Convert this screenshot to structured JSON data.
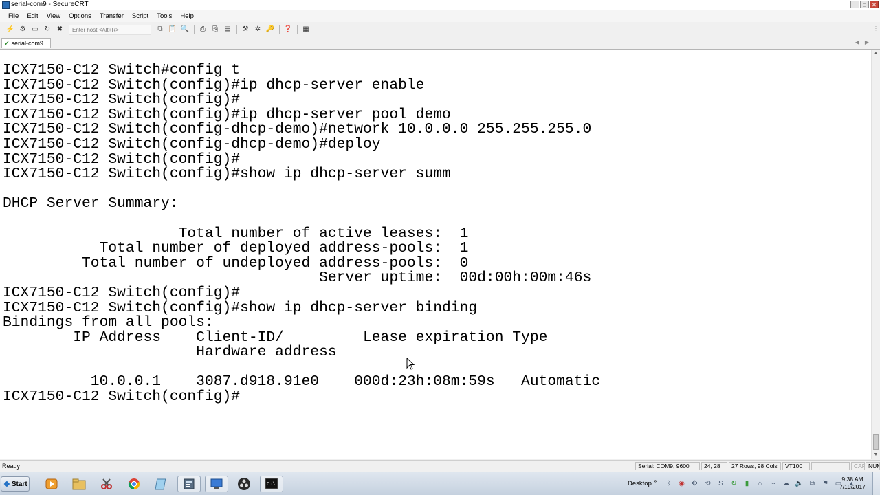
{
  "window": {
    "title": "serial-com9 - SecureCRT",
    "buttons": {
      "minimize": "_",
      "maximize": "□",
      "close": "✕"
    }
  },
  "menu": [
    "File",
    "Edit",
    "View",
    "Options",
    "Transfer",
    "Script",
    "Tools",
    "Help"
  ],
  "toolbar": {
    "quick_connect_placeholder": "Enter host <Alt+R>"
  },
  "tabs": [
    {
      "label": "serial-com9",
      "icon": "check-icon"
    }
  ],
  "terminal": {
    "lines": [
      "ICX7150-C12 Switch#config t",
      "ICX7150-C12 Switch(config)#ip dhcp-server enable",
      "ICX7150-C12 Switch(config)#",
      "ICX7150-C12 Switch(config)#ip dhcp-server pool demo",
      "ICX7150-C12 Switch(config-dhcp-demo)#network 10.0.0.0 255.255.255.0",
      "ICX7150-C12 Switch(config-dhcp-demo)#deploy",
      "ICX7150-C12 Switch(config)#",
      "ICX7150-C12 Switch(config)#show ip dhcp-server summ",
      "",
      "DHCP Server Summary:",
      "",
      "                    Total number of active leases:  1",
      "           Total number of deployed address-pools:  1",
      "         Total number of undeployed address-pools:  0",
      "                                    Server uptime:  00d:00h:00m:46s",
      "ICX7150-C12 Switch(config)#",
      "ICX7150-C12 Switch(config)#show ip dhcp-server binding",
      "Bindings from all pools:",
      "        IP Address    Client-ID/         Lease expiration Type",
      "                      Hardware address",
      "",
      "          10.0.0.1    3087.d918.91e0    000d:23h:08m:59s   Automatic",
      "ICX7150-C12 Switch(config)#"
    ]
  },
  "status": {
    "ready": "Ready",
    "connection": "Serial: COM9, 9600",
    "cursor_pos": "24, 28",
    "dimensions": "27 Rows, 98 Cols",
    "emulation": "VT100",
    "blank": "",
    "cap": "CAP",
    "num": "NUM"
  },
  "taskbar": {
    "start_label": "Start",
    "desktop_label": "Desktop",
    "time": "9:38 AM",
    "date": "7/19/2017"
  }
}
